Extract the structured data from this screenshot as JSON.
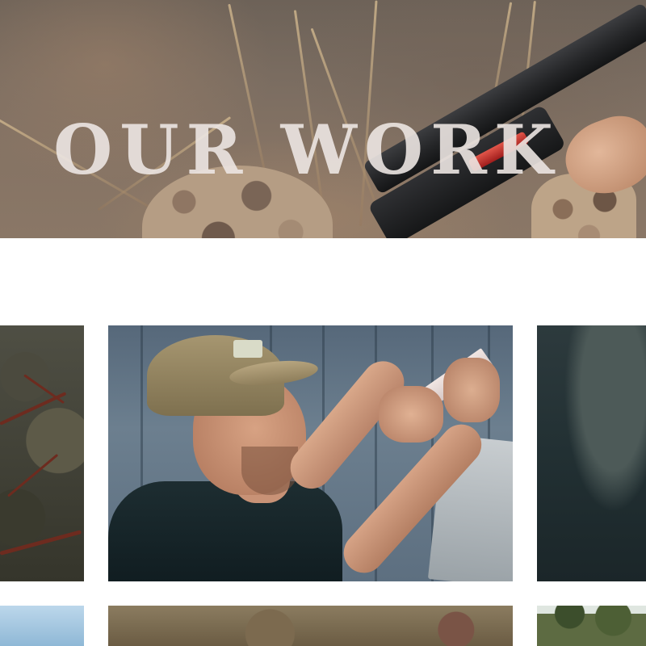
{
  "hero": {
    "title": "OUR WORK"
  },
  "gallery": {
    "tiles": [
      {
        "id": "forest-branches",
        "row": 1,
        "position": "left"
      },
      {
        "id": "man-with-cap-workshop",
        "row": 1,
        "position": "center"
      },
      {
        "id": "dark-scene",
        "row": 1,
        "position": "right"
      },
      {
        "id": "sky",
        "row": 2,
        "position": "left"
      },
      {
        "id": "brown-scene",
        "row": 2,
        "position": "center"
      },
      {
        "id": "trees",
        "row": 2,
        "position": "right"
      }
    ]
  },
  "colors": {
    "background": "#ffffff",
    "hero_title": "#ece6e2",
    "hero_tint": "#7b6d61"
  }
}
